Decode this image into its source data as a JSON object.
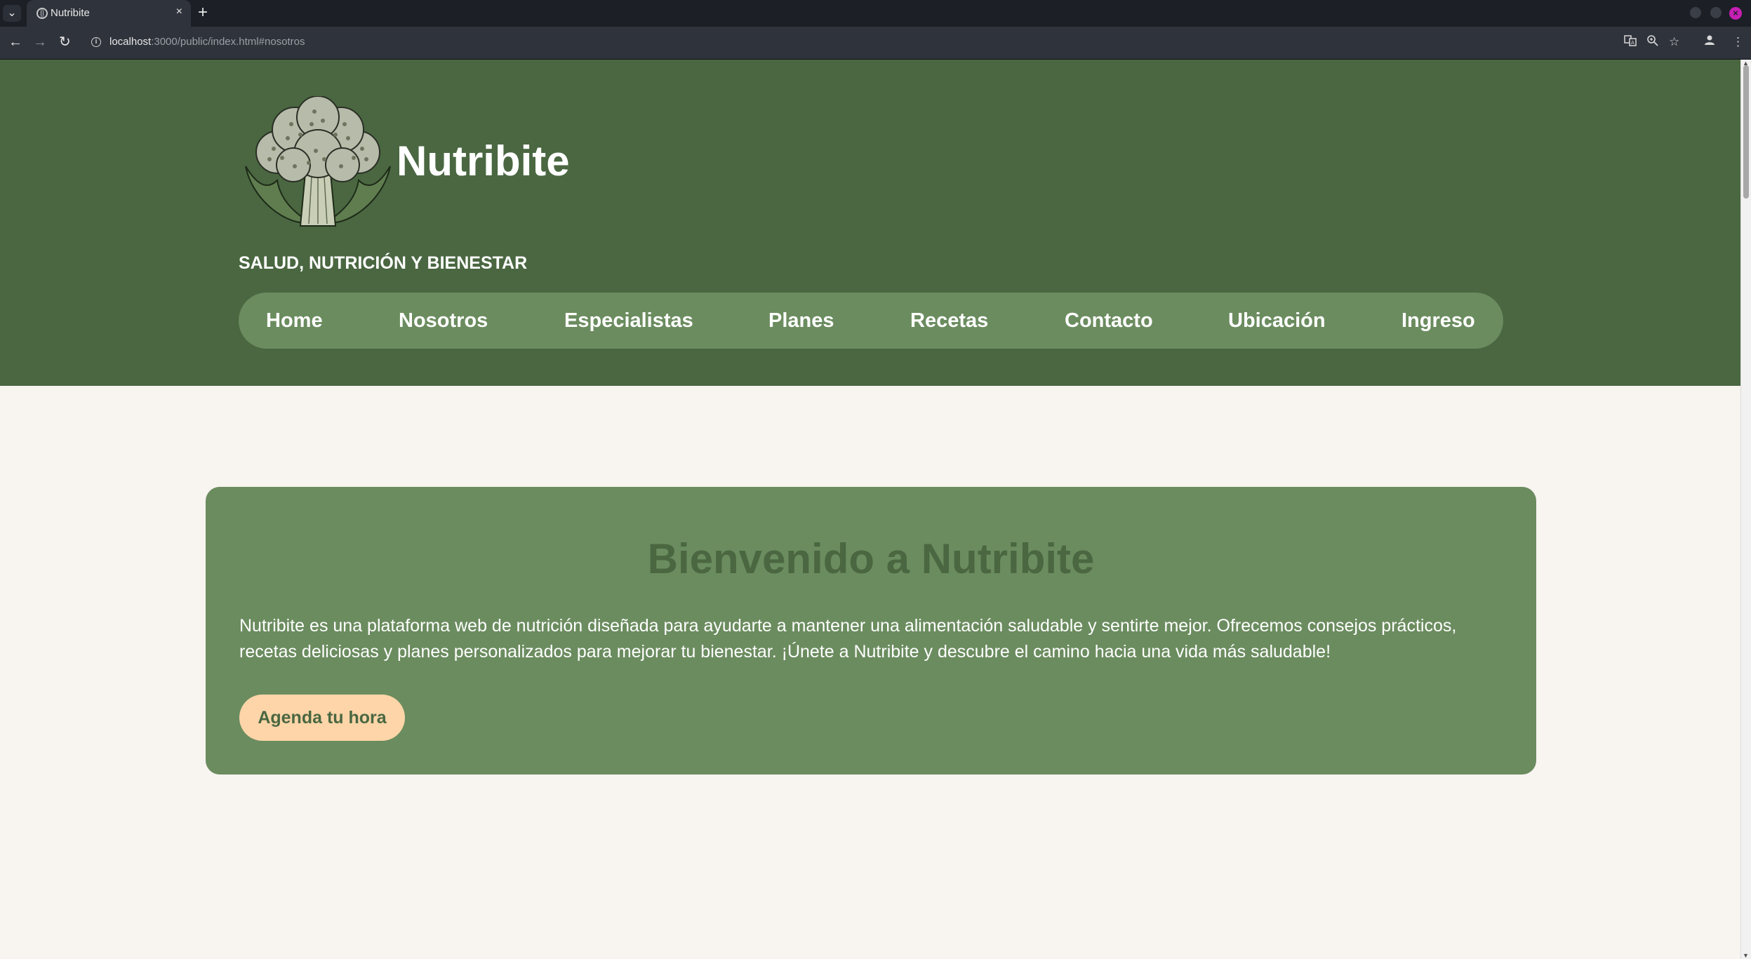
{
  "browser": {
    "tab_title": "Nutribite",
    "tab_close": "×",
    "new_tab": "+",
    "url_host": "localhost",
    "url_rest": ":3000/public/index.html#nosotros"
  },
  "site": {
    "brand": "Nutribite",
    "tagline": "SALUD, NUTRICIÓN Y BIENESTAR",
    "logo_icon": "broccoli-logo",
    "nav": [
      {
        "label": "Home"
      },
      {
        "label": "Nosotros"
      },
      {
        "label": "Especialistas"
      },
      {
        "label": "Planes"
      },
      {
        "label": "Recetas"
      },
      {
        "label": "Contacto"
      },
      {
        "label": "Ubicación"
      },
      {
        "label": "Ingreso"
      }
    ]
  },
  "welcome": {
    "title": "Bienvenido a Nutribite",
    "text": "Nutribite es una plataforma web de nutrición diseñada para ayudarte a mantener una alimentación saludable y sentirte mejor. Ofrecemos consejos prácticos, recetas deliciosas y planes personalizados para mejorar tu bienestar. ¡Únete a Nutribite y descubre el camino hacia una vida más saludable!",
    "cta": "Agenda tu hora"
  },
  "colors": {
    "header_bg": "#4a6741",
    "accent_green": "#6b8c5f",
    "cta_bg": "#fdd5a8",
    "page_bg": "#f8f4f0"
  }
}
